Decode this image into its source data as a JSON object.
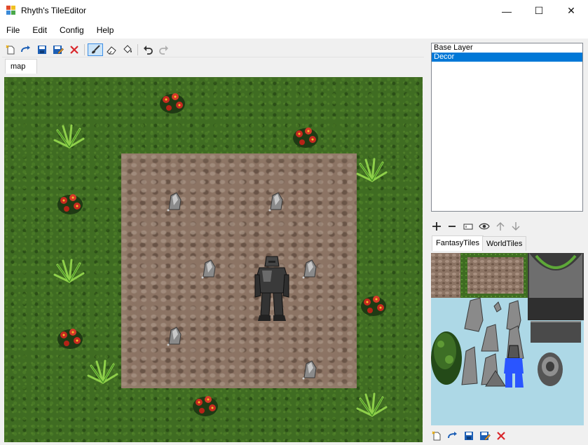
{
  "window": {
    "title": "Rhyth's TileEditor"
  },
  "window_controls": {
    "minimize_label": "—",
    "maximize_label": "☐",
    "close_label": "✕"
  },
  "menu": {
    "items": [
      "File",
      "Edit",
      "Config",
      "Help"
    ]
  },
  "toolbar": {
    "buttons": [
      "new-icon",
      "open-icon",
      "save-icon",
      "save-as-icon",
      "close-icon",
      "brush-icon",
      "eraser-icon",
      "fill-icon",
      "undo-icon",
      "redo-icon"
    ],
    "active_tool": "brush-icon"
  },
  "map_tab": {
    "label": "map"
  },
  "layers": {
    "items": [
      "Base Layer",
      "Decor"
    ],
    "selected": "Decor"
  },
  "layer_toolbar": {
    "buttons": [
      "add-icon",
      "remove-icon",
      "rename-icon",
      "visibility-icon",
      "arrow-up-icon",
      "arrow-down-icon"
    ]
  },
  "tileset_tabs": {
    "items": [
      "FantasyTiles",
      "WorldTiles"
    ],
    "active": "FantasyTiles"
  },
  "bottom_toolbar": {
    "buttons": [
      "new-icon",
      "open-icon",
      "save-icon",
      "save-as-icon",
      "close-icon"
    ]
  },
  "colors": {
    "accent": "#0078d7",
    "grass": "#3f6c22",
    "dirt": "#8c7464",
    "tileset_bg": "#add8e6",
    "close_red": "#d9262b",
    "save_blue": "#1d5fb5"
  }
}
